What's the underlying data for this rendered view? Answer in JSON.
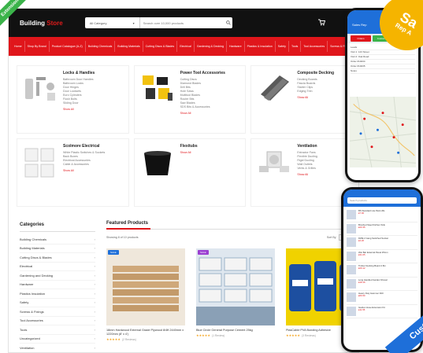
{
  "site": {
    "logo_main": "Building",
    "logo_accent": "Store",
    "brand_color": "#e0161b"
  },
  "search": {
    "category": "All Category",
    "placeholder": "Search over 10,000 products"
  },
  "nav": [
    "Home",
    "Shop By Brand",
    "Product Catalogue (A-Z)",
    "Building Chemicals",
    "Building Materials",
    "Cutting Discs & Blades",
    "Electrical",
    "Gardening & Decking",
    "Hardware",
    "Plastics & Insulation",
    "Safety",
    "Tools",
    "Tool Accessories",
    "Screws & Fixings"
  ],
  "tiles": [
    {
      "title": "Locks & Handles",
      "links": [
        "Bathroom Door Handles",
        "Bathroom Locks",
        "Door Hinges",
        "Door Locksets",
        "Euro Cylinders",
        "Flush Bolts",
        "Sliding Door"
      ],
      "show_all": "Show All"
    },
    {
      "title": "Power Tool Accessories",
      "links": [
        "Cutting Discs",
        "Diamond Blades",
        "Drill Bits",
        "Hole Saws",
        "Multitool Blades",
        "Router Bits",
        "Saw Blades",
        "SDS Bits & Accessories"
      ],
      "show_all": "Show All"
    },
    {
      "title": "Composite Decking",
      "links": [
        "Decking Boards",
        "Fascia Boards",
        "Starter Clips",
        "Edging Trim"
      ],
      "show_all": "Show All"
    },
    {
      "title": "Scolmore Electrical",
      "links": [
        "White Plastic Switches & Sockets",
        "Back Boxes",
        "Electrical Accessories",
        "Cable & Accessories"
      ],
      "show_all": "Show All"
    },
    {
      "title": "Flexitubs",
      "links": [],
      "show_all": "Show All"
    },
    {
      "title": "Ventilation",
      "links": [
        "Extractor Fans",
        "Flexible Ducting",
        "Rigid Ducting",
        "Wall Outlets",
        "Vents & Grilles"
      ],
      "show_all": "Show All"
    }
  ],
  "sidebar": {
    "title": "Categories",
    "items": [
      "Building Chemicals",
      "Building Materials",
      "Cutting Discs & Blades",
      "Electrical",
      "Gardening and Decking",
      "Hardware",
      "Plastics Insulation",
      "Safety",
      "Screws & Fixings",
      "Tool Accessories",
      "Tools",
      "Uncategorized",
      "Ventilation"
    ]
  },
  "featured": {
    "title": "Featured Products",
    "showing": "Showing 8 of 10 products",
    "sort_label": "Sort By",
    "sort_value": "Default",
    "products": [
      {
        "title": "18mm Hardwood External Grade Plywood 8/4ft 2440mm x 1220mm (8' x 4')",
        "stars": "★★★★★",
        "reviews": "(2 Reviews)",
        "badge": "SALE"
      },
      {
        "title": "Blue Circle General Purpose Cement 25kg",
        "stars": "★★★★★",
        "reviews": "(1 Review)",
        "badge": "SALE"
      },
      {
        "title": "PlasCable PVA Bonding Adhesive",
        "stars": "★★★★★",
        "reviews": "(3 Reviews)",
        "badge": ""
      }
    ]
  },
  "overlay": {
    "left_ribbon": "Extensions",
    "badge_big": "Sa",
    "badge_small": "Rep A",
    "blue_ribbon": "Cust",
    "phone1_title": "Sales Rep",
    "phone1_tabs": [
      "Orders",
      "Customers",
      "Map"
    ],
    "phone1_list": [
      "Leads",
      "Visit 1: 123 Street",
      "Visit 2: Oak Road",
      "Order #10234",
      "Order #10235",
      "Notes"
    ],
    "phone2_search": "Search products",
    "phone2_items": [
      {
        "name": "BS Standard Lite Paint 20L",
        "price": "£7.06"
      },
      {
        "name": "Brushed Steel Kitchen Sink",
        "price": "£20.35"
      },
      {
        "name": "DWE 2 Gang Switched Socket",
        "price": "£4.20"
      },
      {
        "name": "Wet Bar External Panel 25mm",
        "price": "£31.05"
      },
      {
        "name": "Timber Decking Board 4.8m",
        "price": "£29.12"
      },
      {
        "name": "Long Handled Garden Shovel",
        "price": "£18.16"
      },
      {
        "name": "Heavy Duty Hammer Drill",
        "price": "£66.50"
      },
      {
        "name": "Garden Hose Extension Kit",
        "price": "£11.55"
      }
    ]
  }
}
